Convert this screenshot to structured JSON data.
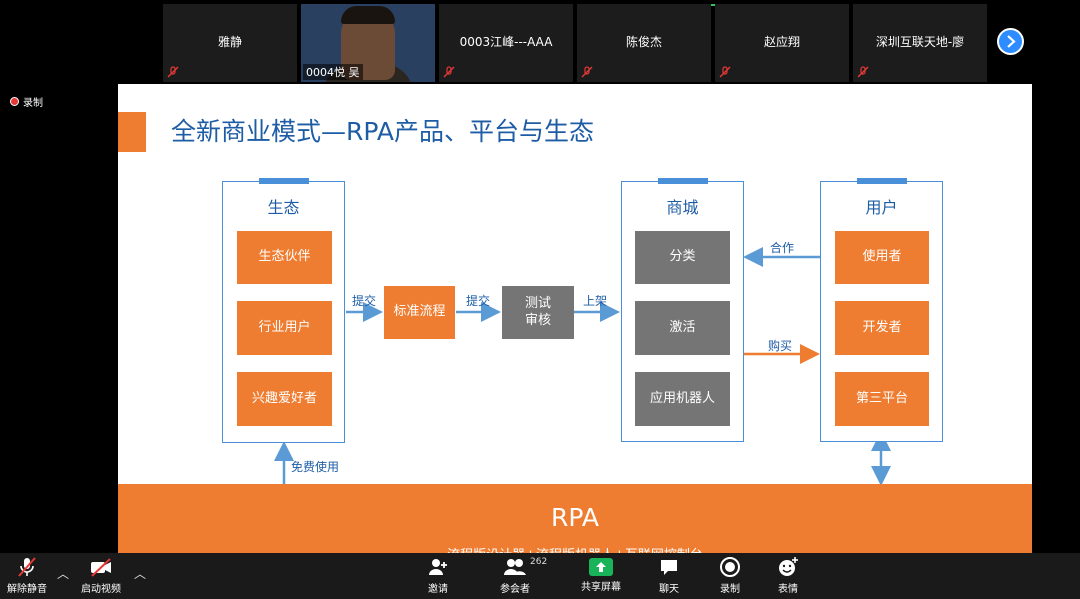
{
  "participants": [
    {
      "name": "雅静"
    },
    {
      "name": "0004悦 吴"
    },
    {
      "name": "0003江峰---AAA"
    },
    {
      "name": "陈俊杰"
    },
    {
      "name": "赵应翔"
    },
    {
      "name": "深圳互联天地-廖"
    }
  ],
  "recording": {
    "label": "录制"
  },
  "slide": {
    "title": "全新商业模式—RPA产品、平台与生态",
    "eco": {
      "title": "生态",
      "items": [
        "生态伙伴",
        "行业用户",
        "兴趣爱好者"
      ]
    },
    "flow": {
      "submit1": "提交",
      "standard": "标准流程",
      "submit2": "提交",
      "test": "测试\n审核",
      "listing": "上架"
    },
    "mall": {
      "title": "商城",
      "items": [
        "分类",
        "激活",
        "应用机器人"
      ]
    },
    "users": {
      "title": "用户",
      "items": [
        "使用者",
        "开发者",
        "第三平台"
      ]
    },
    "cooperate": "合作",
    "buy": "购买",
    "free_use": "免费使用",
    "rpa": {
      "title": "RPA",
      "subtitle": "流程版设计器+流程版机器人+互联网控制台"
    }
  },
  "toolbar": {
    "unmute": "解除静音",
    "start_video": "启动视频",
    "invite": "邀请",
    "participants": "参会者",
    "participant_count": "262",
    "share": "共享屏幕",
    "chat": "聊天",
    "record": "录制",
    "reactions": "表情"
  },
  "colors": {
    "accent_orange": "#ee7d31",
    "title_blue": "#1e5da6",
    "border_blue": "#4a90d9",
    "box_gray": "#757575",
    "share_green": "#19b35a"
  }
}
